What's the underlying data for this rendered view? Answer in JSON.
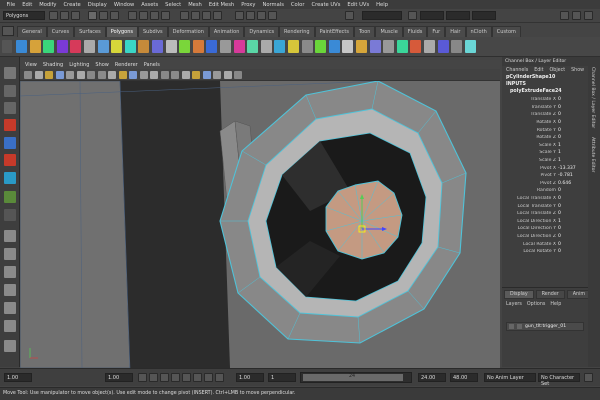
{
  "menu": [
    "File",
    "Edit",
    "Modify",
    "Create",
    "Display",
    "Window",
    "Assets",
    "Select",
    "Mesh",
    "Edit Mesh",
    "Proxy",
    "Normals",
    "Color",
    "Create UVs",
    "Edit UVs",
    "Help"
  ],
  "status": {
    "mode": "Polygons"
  },
  "shelf_tabs": [
    "General",
    "Curves",
    "Surfaces",
    "Polygons",
    "Subdivs",
    "Deformation",
    "Animation",
    "Dynamics",
    "Rendering",
    "PaintEffects",
    "Toon",
    "Muscle",
    "Fluids",
    "Fur",
    "Hair",
    "nCloth",
    "Custom"
  ],
  "shelf_active": "Polygons",
  "viewport_menu": [
    "View",
    "Shading",
    "Lighting",
    "Show",
    "Renderer",
    "Panels"
  ],
  "channel_box": {
    "title": "Channel Box / Layer Editor",
    "menu": [
      "Channels",
      "Edit",
      "Object",
      "Show"
    ],
    "shape": "pCylinderShape10",
    "inputs_label": "INPUTS",
    "node": "polyExtrudeFace24",
    "rows": [
      {
        "n": "Translate X",
        "v": "0"
      },
      {
        "n": "Translate Y",
        "v": "0"
      },
      {
        "n": "Translate Z",
        "v": "0"
      },
      {
        "n": "Rotate X",
        "v": "0"
      },
      {
        "n": "Rotate Y",
        "v": "0"
      },
      {
        "n": "Rotate Z",
        "v": "0"
      },
      {
        "n": "Scale X",
        "v": "1"
      },
      {
        "n": "Scale Y",
        "v": "1"
      },
      {
        "n": "Scale Z",
        "v": "1"
      },
      {
        "n": "Pivot X",
        "v": "-13.337"
      },
      {
        "n": "Pivot Y",
        "v": "-0.781"
      },
      {
        "n": "Pivot Z",
        "v": "0.646"
      },
      {
        "n": "Random",
        "v": "0"
      },
      {
        "n": "Local Translate X",
        "v": "0"
      },
      {
        "n": "Local Translate Y",
        "v": "0"
      },
      {
        "n": "Local Translate Z",
        "v": "0"
      },
      {
        "n": "Local Direction X",
        "v": "1"
      },
      {
        "n": "Local Direction Y",
        "v": "0"
      },
      {
        "n": "Local Direction Z",
        "v": "0"
      },
      {
        "n": "Local Rotate X",
        "v": "0"
      },
      {
        "n": "Local Rotate Y",
        "v": "0"
      }
    ]
  },
  "layer_editor": {
    "tabs": [
      "Display",
      "Render",
      "Anim"
    ],
    "menu": [
      "Layers",
      "Options",
      "Help"
    ],
    "layer_name": "gun_tlt:trigger_01"
  },
  "attribute_strip": [
    "Channel Box / Layer Editor",
    "Attribute Editor"
  ],
  "timeline": {
    "start_field": "1.00",
    "current": "1.00",
    "range_start": "1.00",
    "range_frame": "1",
    "range_mark": "24",
    "range_end": "24.00",
    "end_field": "48.00",
    "anim_layer": "No Anim Layer",
    "char_set": "No Character Set"
  },
  "help_line": "Move Tool: Use manipulator to move object(s). Use edit mode to change pivot (INSERT). Ctrl+LMB to move perpendicular.",
  "colors": {
    "wire": "#4fc3d9",
    "face": "#c49a82",
    "selected": "#ffffff"
  }
}
